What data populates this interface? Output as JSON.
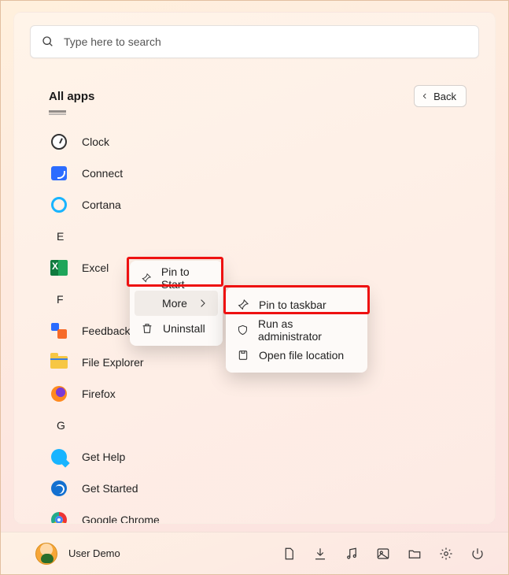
{
  "search": {
    "placeholder": "Type here to search"
  },
  "header": {
    "title": "All apps",
    "back_label": "Back"
  },
  "sections": {
    "e": "E",
    "f": "F",
    "g": "G"
  },
  "apps": {
    "clock": "Clock",
    "connect": "Connect",
    "cortana": "Cortana",
    "excel": "Excel",
    "feedback": "Feedback",
    "file_explorer": "File Explorer",
    "firefox": "Firefox",
    "get_help": "Get Help",
    "get_started": "Get Started",
    "google_chrome": "Google Chrome"
  },
  "context_menu": {
    "pin_to_start": "Pin to Start",
    "more": "More",
    "uninstall": "Uninstall"
  },
  "more_submenu": {
    "pin_to_taskbar": "Pin to taskbar",
    "run_as_admin": "Run as administrator",
    "open_file_location": "Open file location"
  },
  "footer": {
    "username": "User Demo",
    "tray": [
      "documents",
      "downloads",
      "music",
      "pictures",
      "files",
      "settings",
      "power"
    ]
  }
}
